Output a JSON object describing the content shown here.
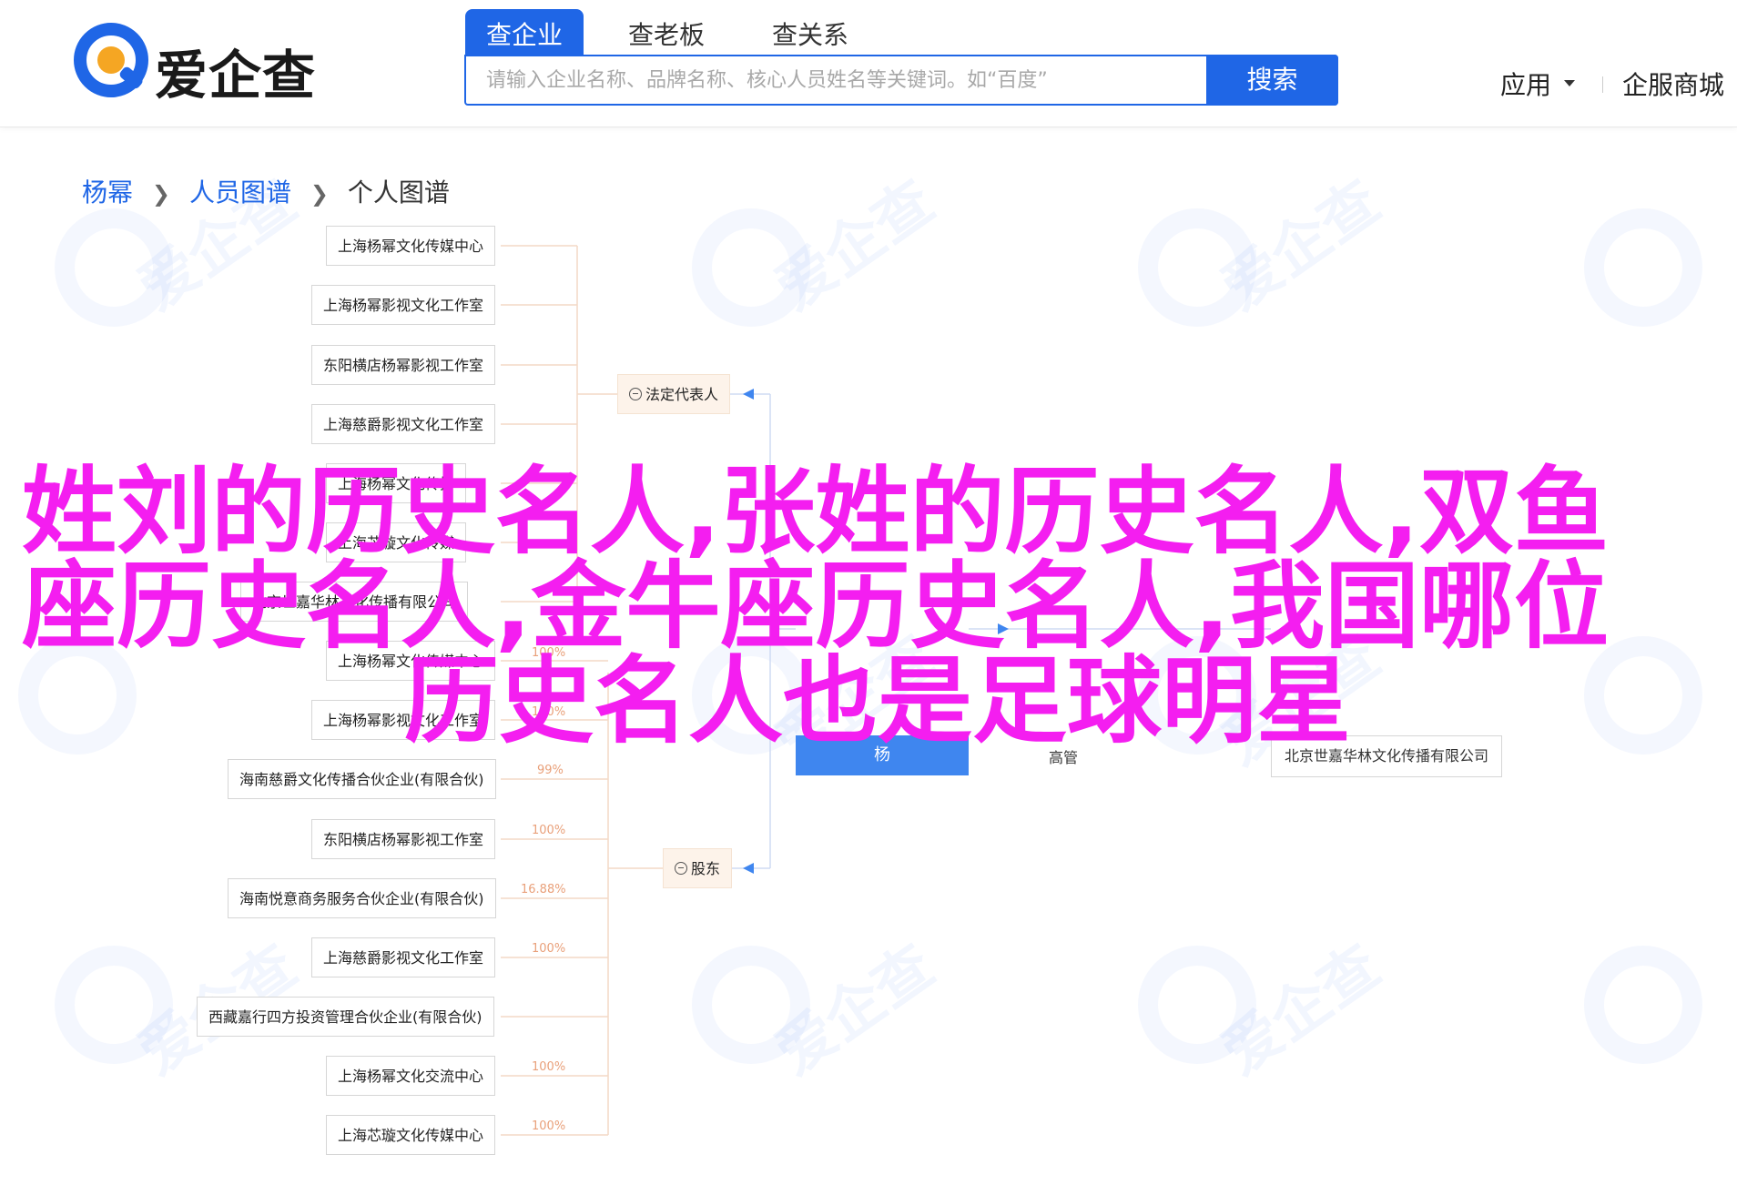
{
  "brand": {
    "name": "爱企查",
    "colors": {
      "primary": "#1f66e6",
      "logo_orange": "#f5a623",
      "headline": "#f41ef0"
    }
  },
  "header": {
    "tabs": [
      {
        "label": "查企业",
        "active": true
      },
      {
        "label": "查老板",
        "active": false
      },
      {
        "label": "查关系",
        "active": false
      }
    ],
    "search": {
      "placeholder": "请输入企业名称、品牌名称、核心人员姓名等关键词。如“百度”",
      "button_label": "搜索"
    },
    "nav": {
      "app_label": "应用",
      "enterprise_label": "企服商城"
    }
  },
  "breadcrumb": {
    "items": [
      {
        "label": "杨幂",
        "link": true
      },
      {
        "label": "人员图谱",
        "link": true
      },
      {
        "label": "个人图谱",
        "link": false
      }
    ]
  },
  "graph": {
    "center": "杨",
    "category_legal": "法定代表人",
    "category_shareholder": "股东",
    "legal_nodes": [
      "上海杨幂文化传媒中心",
      "上海杨幂影视文化工作室",
      "东阳横店杨幂影视工作室",
      "上海慈爵影视文化工作室",
      "上海杨幂文化传播",
      "上海芯璇文化传媒",
      "北京世嘉华林文化传播有限公司",
      "上海杨幂文化传媒中心",
      "上海杨幂影视文化工作室"
    ],
    "shareholder_nodes": [
      {
        "name": "海南慈爵文化传播合伙企业(有限合伙)",
        "pct": "99%"
      },
      {
        "name": "东阳横店杨幂影视工作室",
        "pct": "100%"
      },
      {
        "name": "海南悦意商务服务合伙企业(有限合伙)",
        "pct": "16.88%"
      },
      {
        "name": "上海慈爵影视文化工作室",
        "pct": "100%"
      },
      {
        "name": "西藏嘉行四方投资管理合伙企业(有限合伙)",
        "pct": ""
      },
      {
        "name": "上海杨幂文化交流中心",
        "pct": "100%"
      },
      {
        "name": "上海芯璇文化传媒中心",
        "pct": "100%"
      }
    ],
    "partial_pcts": [
      "100%",
      "100%",
      "100%"
    ],
    "right_label": "高管",
    "right_node": "北京世嘉华林文化传播有限公司"
  },
  "headline": {
    "line1": "姓刘的历史名人,张姓的历史名人,双鱼",
    "line2": "座历史名人,金牛座历史名人,我国哪位",
    "line3": "历史名人也是足球明星"
  },
  "icons": [
    "logo-icon",
    "chevron-right-icon",
    "caret-down-icon",
    "collapse-icon",
    "arrow-left-icon"
  ]
}
